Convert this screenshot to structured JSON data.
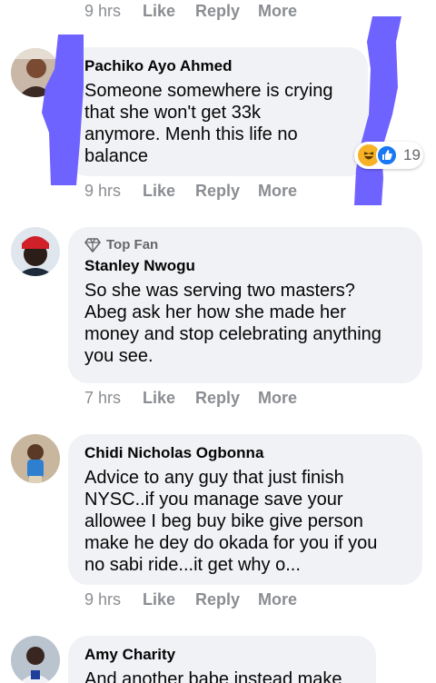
{
  "top_actions": {
    "time": "9 hrs",
    "like": "Like",
    "reply": "Reply",
    "more": "More"
  },
  "comments": [
    {
      "author": "Pachiko Ayo Ahmed",
      "text_lines": [
        "Someone somewhere is crying",
        "that she won't get 33k",
        "anymore. Menh this life no",
        "balance"
      ],
      "reaction_count": "19",
      "reaction_icons": [
        "haha-icon",
        "like-icon"
      ],
      "time": "9 hrs",
      "like": "Like",
      "reply": "Reply",
      "more": "More"
    },
    {
      "badge": "Top Fan",
      "author": "Stanley Nwogu",
      "text_lines": [
        "So she was serving two masters?",
        "Abeg ask her how she made her",
        "money and stop celebrating anything",
        "you see."
      ],
      "time": "7 hrs",
      "like": "Like",
      "reply": "Reply",
      "more": "More"
    },
    {
      "author": "Chidi Nicholas Ogbonna",
      "text_lines": [
        "Advice to any guy that just finish",
        "NYSC..if you manage save your",
        "allowee I beg buy bike give person",
        "make he dey do okada for you if you",
        "no sabi ride...it get why o..."
      ],
      "time": "9 hrs",
      "like": "Like",
      "reply": "Reply",
      "more": "More"
    },
    {
      "author": "Amy Charity",
      "text_lines": [
        "And another babe instead make"
      ]
    }
  ],
  "colors": {
    "bubble": "#f0f2f5",
    "meta": "#8a8d91",
    "like_blue": "#1877f2",
    "haha_yellow": "#f7b125",
    "scribble": "#6f63ff"
  }
}
